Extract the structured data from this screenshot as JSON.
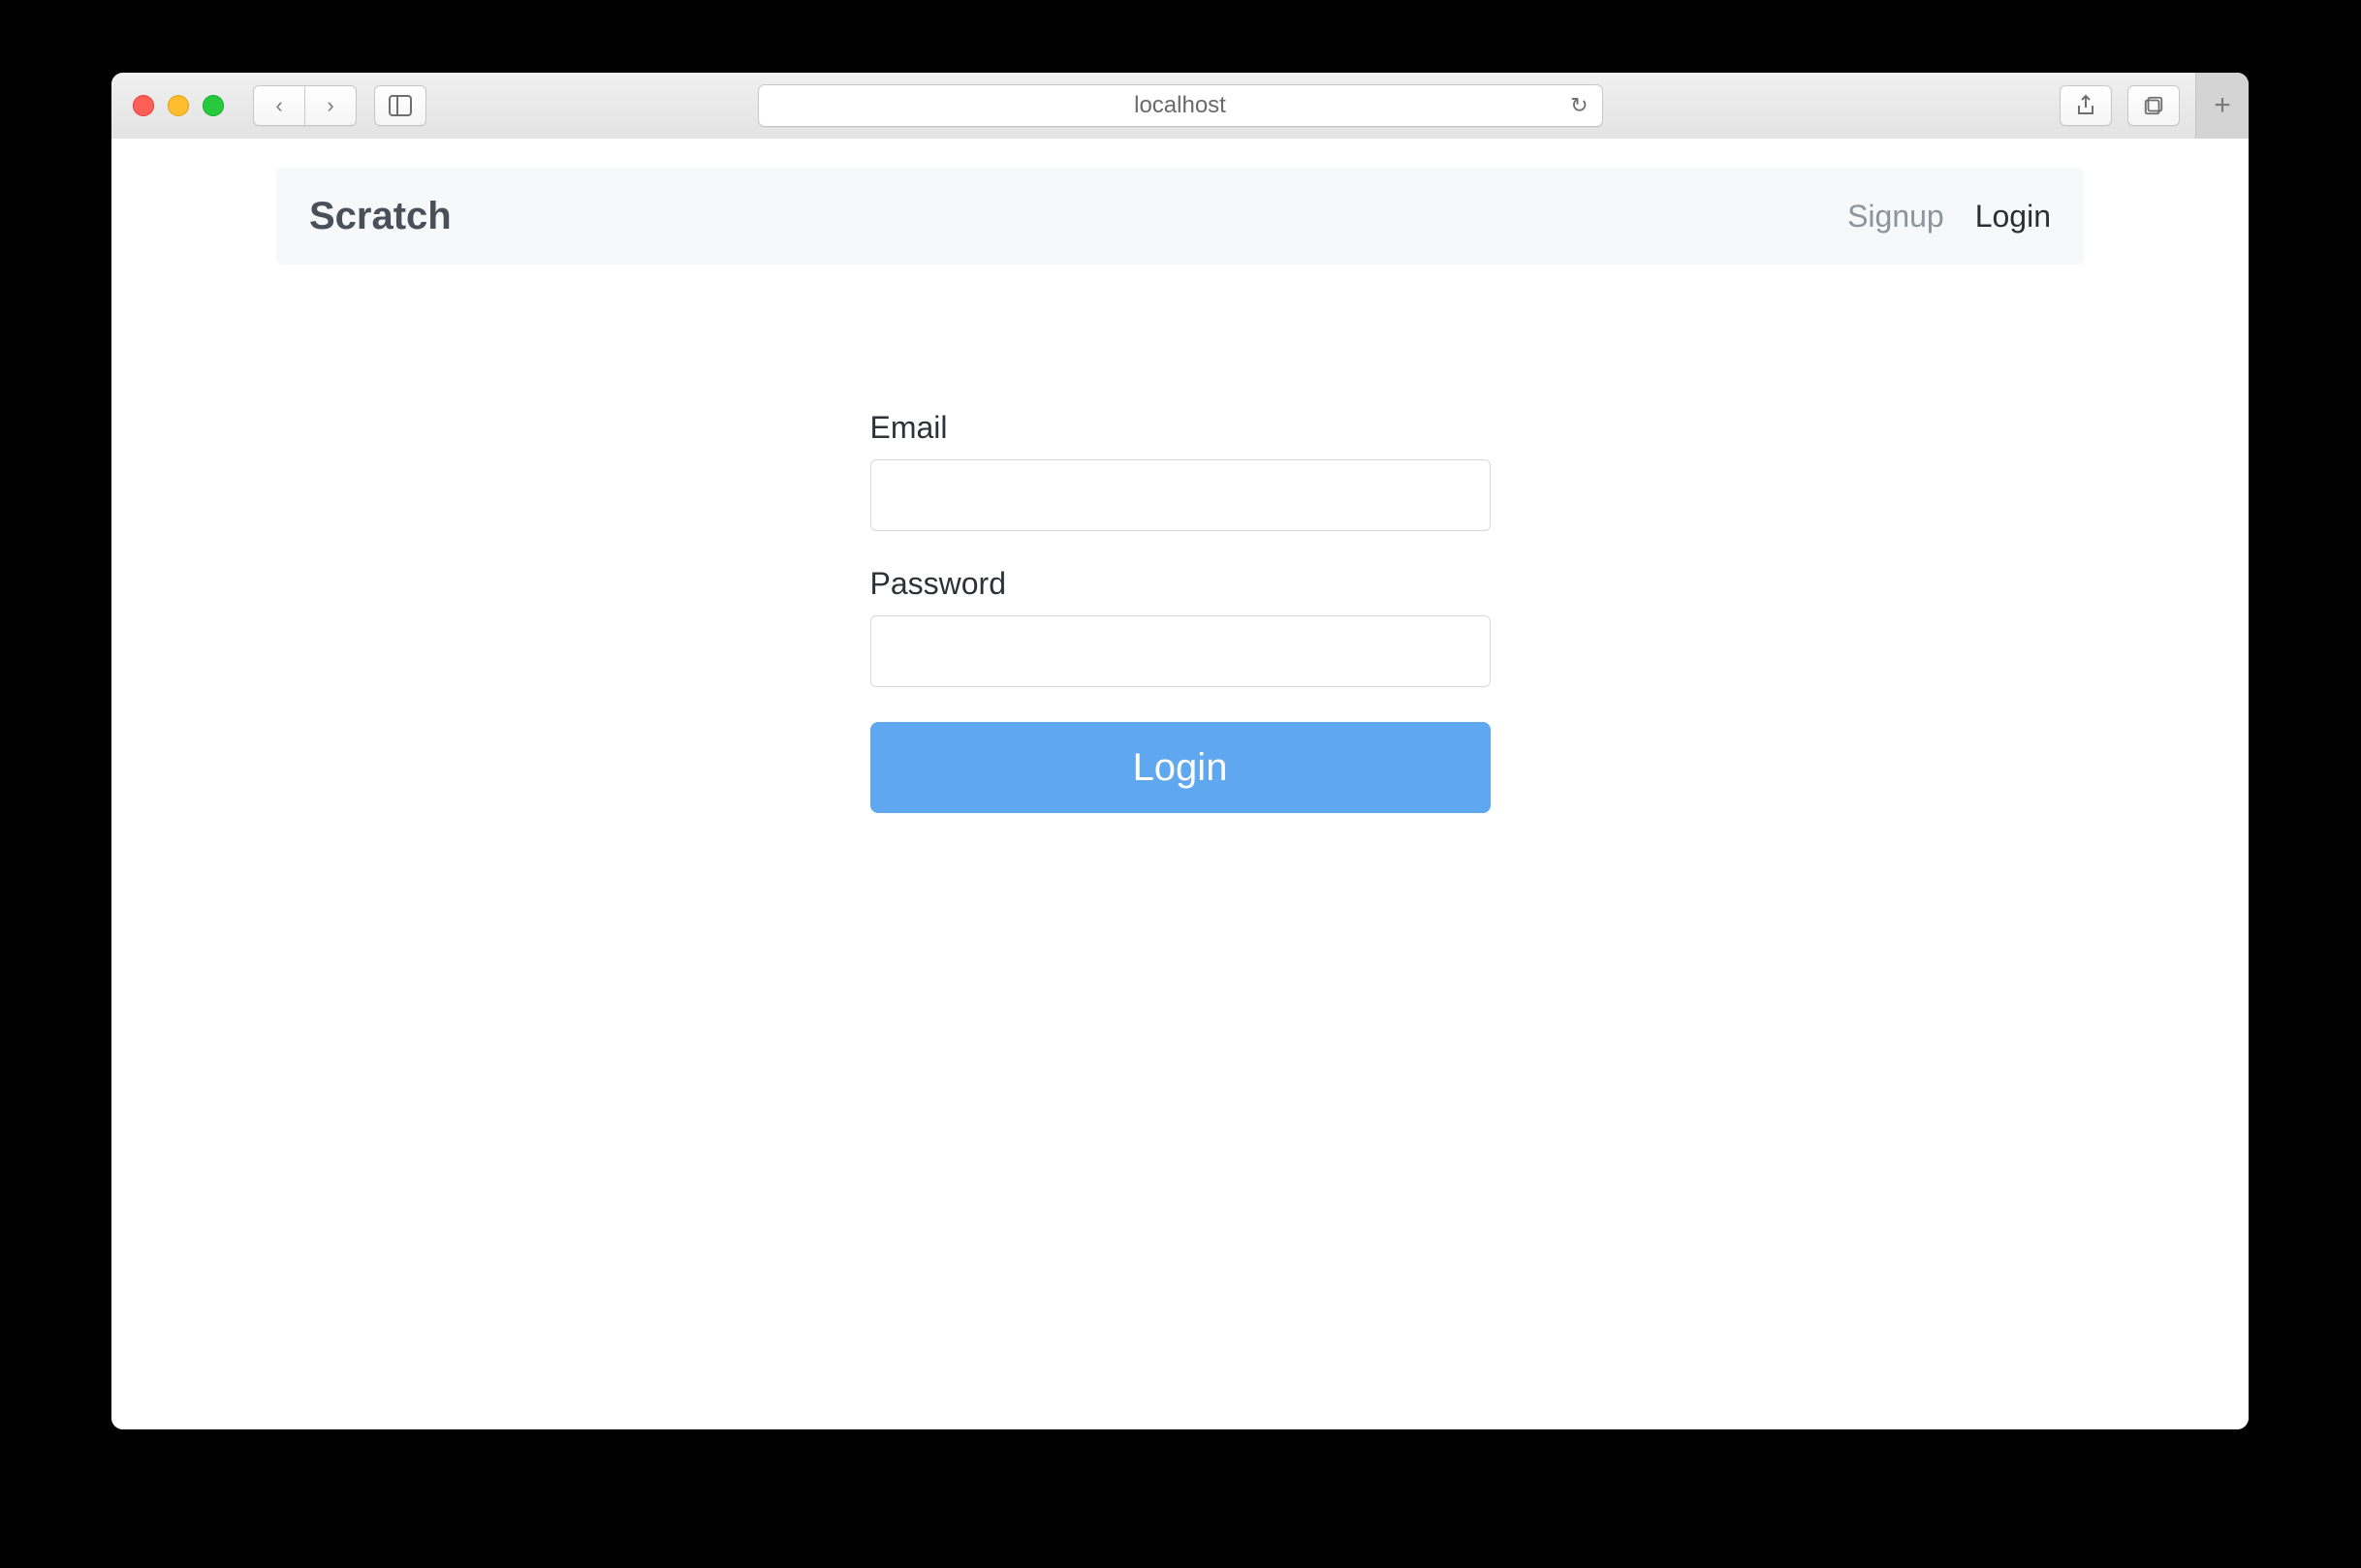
{
  "browser": {
    "url": "localhost"
  },
  "navbar": {
    "brand": "Scratch",
    "signup_label": "Signup",
    "login_label": "Login"
  },
  "form": {
    "email_label": "Email",
    "email_value": "",
    "password_label": "Password",
    "password_value": "",
    "submit_label": "Login"
  },
  "colors": {
    "primary": "#5fa8ef",
    "navbar_bg": "#f7f8fa",
    "text_dark": "#2e3238",
    "text_muted": "#8c949d"
  }
}
